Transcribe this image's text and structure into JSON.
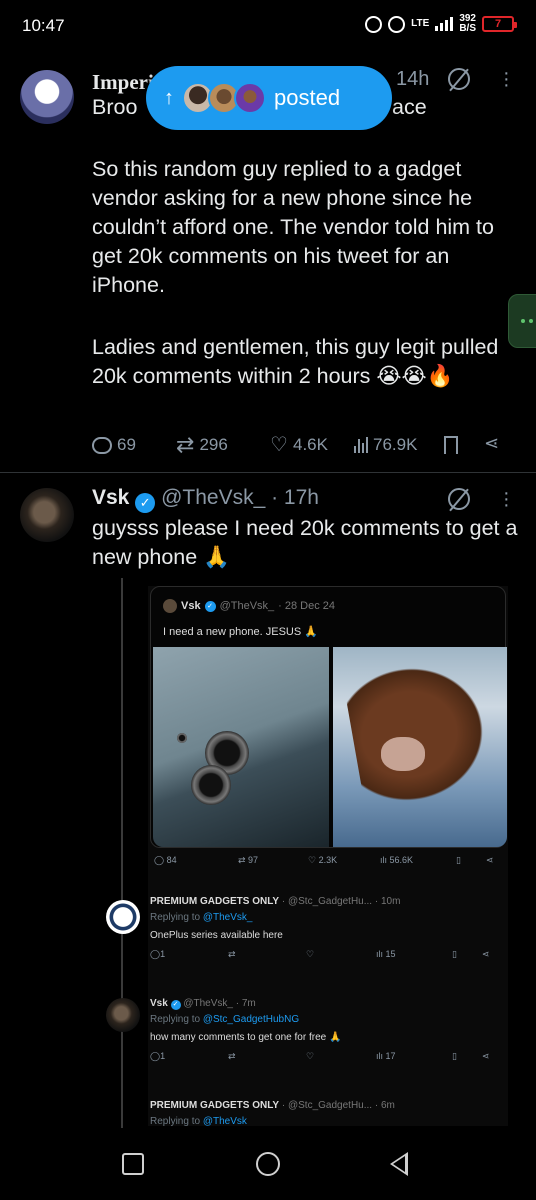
{
  "status_bar": {
    "time": "10:47",
    "network": "LTE",
    "speed": "392",
    "speed_unit": "B/S",
    "battery": "7",
    "battery_color": "#e0262a"
  },
  "tweet1": {
    "name": "Imperi",
    "time": "14h",
    "line_truncated_start": "Broo",
    "line_truncated_end": "ace",
    "body_p1": "So this random guy replied to a gadget vendor asking for a new phone since he couldn’t afford one. The vendor told him to get 20k comments on his tweet for an iPhone.",
    "body_p2": "Ladies and gentlemen, this guy legit pulled 20k comments within 2 hours 😭😭🔥",
    "replies": "69",
    "retweets": "296",
    "likes": "4.6K",
    "views": "76.9K"
  },
  "posted_pill": {
    "label": "posted",
    "color": "#1d9bf0"
  },
  "tweet2": {
    "name": "Vsk",
    "handle": "@TheVsk_",
    "time": "· 17h",
    "body": "guysss please I need 20k comments to get a new phone 🙏"
  },
  "embed": {
    "quote": {
      "name": "Vsk",
      "handle": "@TheVsk_",
      "date": "· 28 Dec 24",
      "text": "I need a new phone. JESUS 🙏"
    },
    "quote_actions": {
      "replies": "84",
      "retweets": "97",
      "likes": "2.3K",
      "views": "56.6K"
    },
    "replies": [
      {
        "name": "PREMIUM GADGETS ONLY",
        "handle": "@Stc_GadgetHu...",
        "time": "· 10m",
        "replying_to_label": "Replying to",
        "replying_to": "@TheVsk_",
        "text": "OnePlus series available here",
        "reply_count": "1",
        "views": "15"
      },
      {
        "name": "Vsk",
        "handle": "@TheVsk_",
        "time": "· 7m",
        "replying_to_label": "Replying to",
        "replying_to": "@Stc_GadgetHubNG",
        "text": "how many comments to get one for free 🙏",
        "reply_count": "1",
        "views": "17"
      },
      {
        "name": "PREMIUM GADGETS ONLY",
        "handle": "@Stc_GadgetHu...",
        "time": "· 6m",
        "replying_to_label": "Replying to",
        "replying_to": "@TheVsk"
      }
    ]
  }
}
